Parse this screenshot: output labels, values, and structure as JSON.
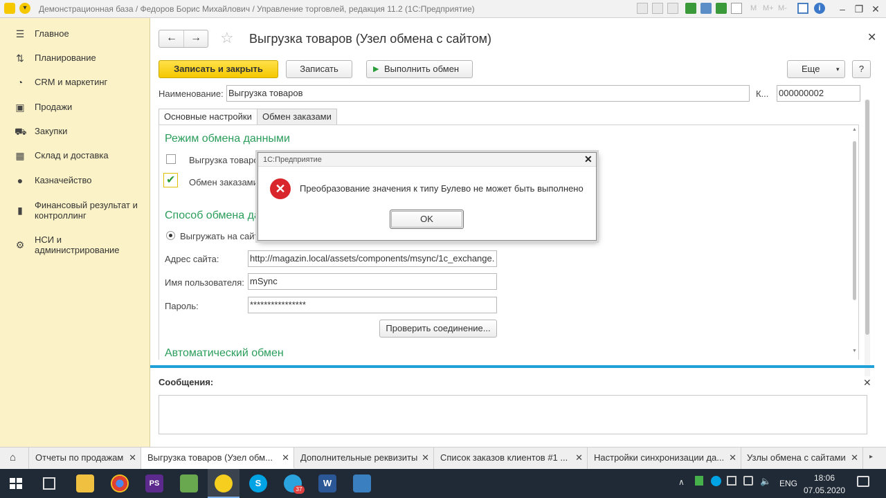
{
  "window": {
    "title": "Демонстрационная база / Федоров Борис Михайлович / Управление торговлей, редакция 11.2  (1С:Предприятие)",
    "toolbar_marks": [
      "M",
      "M+",
      "M-"
    ]
  },
  "sidebar": {
    "items": [
      {
        "label": "Главное",
        "icon": "menu-icon"
      },
      {
        "label": "Планирование",
        "icon": "planning-icon"
      },
      {
        "label": "CRM и маркетинг",
        "icon": "crm-icon"
      },
      {
        "label": "Продажи",
        "icon": "sales-icon"
      },
      {
        "label": "Закупки",
        "icon": "cart-icon"
      },
      {
        "label": "Склад и доставка",
        "icon": "warehouse-icon"
      },
      {
        "label": "Казначейство",
        "icon": "treasury-icon"
      },
      {
        "label": "Финансовый результат и контроллинг",
        "icon": "finance-chart-icon"
      },
      {
        "label": "НСИ и администрирование",
        "icon": "gear-icon"
      }
    ]
  },
  "form": {
    "title": "Выгрузка товаров (Узел обмена с сайтом)",
    "buttons": {
      "save_close": "Записать и закрыть",
      "save": "Записать",
      "run_exchange": "Выполнить обмен",
      "more": "Еще",
      "help": "?"
    },
    "name_label": "Наименование:",
    "name_value": "Выгрузка товаров",
    "code_label": "К...",
    "code_value": "000000002",
    "tabs": [
      "Основные настройки",
      "Обмен заказами"
    ],
    "section_mode": "Режим обмена данными",
    "check_upload": "Выгрузка товаров",
    "check_orders": "Обмен заказами",
    "section_method": "Способ обмена данными",
    "radio_upload": "Выгружать на сайт",
    "site_label": "Адрес сайта:",
    "site_value": "http://magazin.local/assets/components/msync/1c_exchange.",
    "user_label": "Имя пользователя:",
    "user_value": "mSync",
    "password_label": "Пароль:",
    "password_value": "****************",
    "check_connection": "Проверить соединение...",
    "section_auto": "Автоматический обмен",
    "messages_title": "Сообщения:"
  },
  "dialog": {
    "title": "1С:Предприятие",
    "message": "Преобразование значения к типу Булево не может быть выполнено",
    "ok": "OK"
  },
  "open_windows": [
    "Отчеты по продажам",
    "Выгрузка товаров (Узел обм...",
    "Дополнительные реквизиты",
    "Список заказов клиентов #1 ...",
    "Настройки синхронизации да...",
    "Узлы обмена с сайтами"
  ],
  "taskbar": {
    "lang": "ENG",
    "time": "18:06",
    "date": "07.05.2020",
    "telegram_badge": "37"
  },
  "colors": {
    "accent_yellow": "#f5c800",
    "section_green": "#2a9d5a",
    "error_red": "#d9262c",
    "sidebar_bg": "#fbf3c7"
  }
}
